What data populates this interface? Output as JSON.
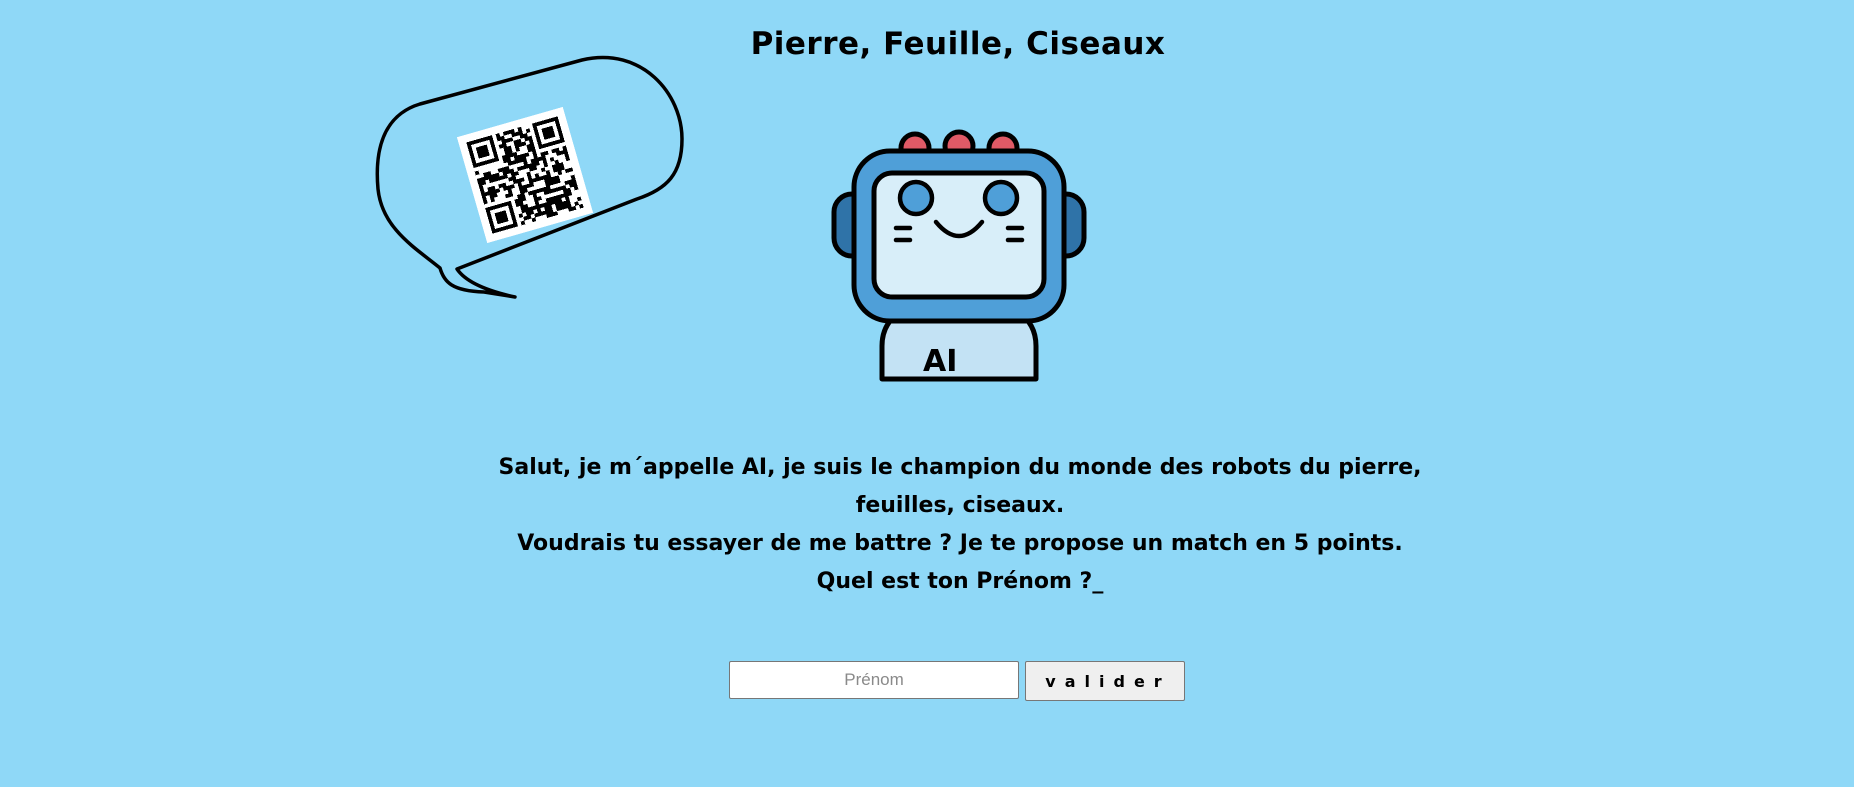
{
  "header": {
    "title": "Pierre, Feuille, Ciseaux"
  },
  "message": {
    "line1": "Salut, je m´appelle AI, je suis le champion du monde des robots du pierre, feuilles, ciseaux.",
    "line2": "Voudrais tu essayer de me battre ? Je te propose un match en 5 points. Quel est ton Prénom ?_"
  },
  "robot": {
    "badge": "AI"
  },
  "form": {
    "name_placeholder": "Prénom",
    "submit_label": "valider"
  },
  "colors": {
    "background": "#8fd8f7",
    "robot_blue": "#4f9fd8",
    "robot_screen": "#d8eef9",
    "robot_lights": "#e05a66"
  },
  "icons": {
    "bubble": "speech-bubble-icon",
    "qr": "qr-code-icon",
    "robot": "robot-icon"
  }
}
